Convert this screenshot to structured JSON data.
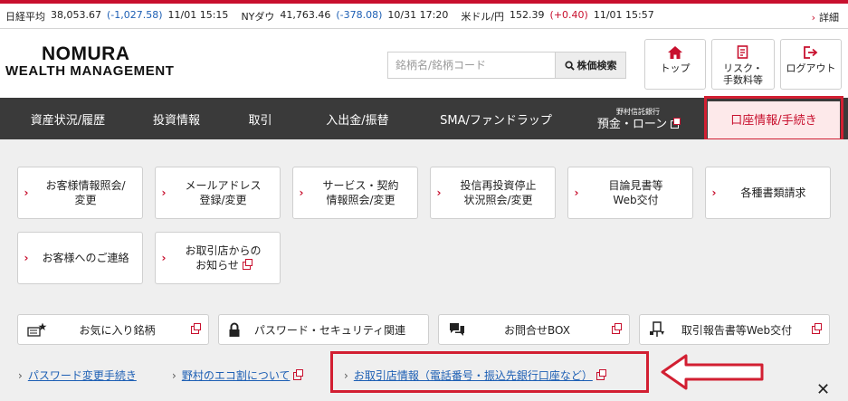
{
  "ticker": {
    "nikkei_label": "日経平均",
    "nikkei_value": "38,053.67",
    "nikkei_change": "(-1,027.58)",
    "nikkei_time": "11/01 15:15",
    "dow_label": "NYダウ",
    "dow_value": "41,763.46",
    "dow_change": "(-378.08)",
    "dow_time": "10/31 17:20",
    "usd_label": "米ドル/円",
    "usd_value": "152.39",
    "usd_change": "(+0.40)",
    "usd_time": "11/01 15:57",
    "detail": "詳細"
  },
  "logo": {
    "line1": "NOMURA",
    "line2": "WEALTH MANAGEMENT"
  },
  "search": {
    "placeholder": "銘柄名/銘柄コード",
    "button": "株価検索"
  },
  "header_buttons": {
    "top": "トップ",
    "risk_1": "リスク・",
    "risk_2": "手数料等",
    "logout": "ログアウト"
  },
  "nav": {
    "assets": "資産状況/履歴",
    "invest": "投資情報",
    "trade": "取引",
    "deposit": "入出金/振替",
    "sma": "SMA/ファンドラップ",
    "bank_small": "野村信託銀行",
    "bank": "預金・ローン",
    "account": "口座情報/手続き"
  },
  "tiles": {
    "t1a": "お客様情報照会/",
    "t1b": "変更",
    "t2a": "メールアドレス",
    "t2b": "登録/変更",
    "t3a": "サービス・契約",
    "t3b": "情報照会/変更",
    "t4a": "投信再投資停止",
    "t4b": "状況照会/変更",
    "t5a": "目論見書等",
    "t5b": "Web交付",
    "t6": "各種書類請求",
    "t7": "お客様へのご連絡",
    "t8a": "お取引店からの",
    "t8b": "お知らせ"
  },
  "wide_buttons": {
    "favorites": "お気に入り銘柄",
    "password": "パスワード・セキュリティ関連",
    "inquiry": "お問合せBOX",
    "report": "取引報告書等Web交付"
  },
  "links": {
    "pw_change": "パスワード変更手続き",
    "eco": "野村のエコ割について",
    "branch": "お取引店情報（電話番号・振込先銀行口座など）"
  },
  "colors": {
    "brand_red": "#c8102e",
    "nav_bg": "#3a3a3a",
    "panel_bg": "#efefef",
    "link_blue": "#1d5fb4"
  }
}
